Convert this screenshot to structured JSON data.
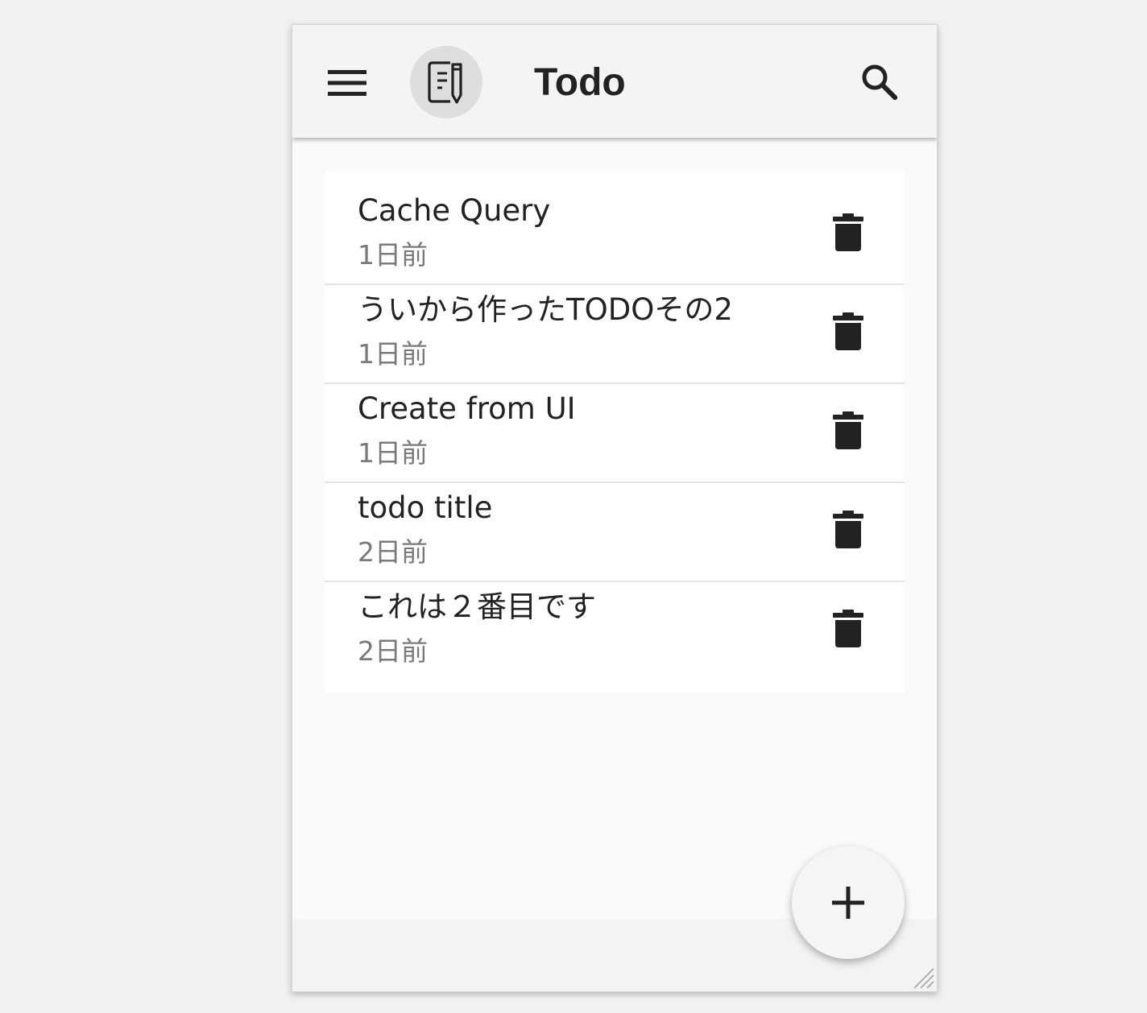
{
  "header": {
    "title": "Todo",
    "menu_icon": "menu-icon",
    "logo_icon": "note-pencil-icon",
    "search_icon": "search-icon"
  },
  "todos": [
    {
      "title": "Cache Query",
      "time": "1日前"
    },
    {
      "title": "ういから作ったTODOその2",
      "time": "1日前"
    },
    {
      "title": "Create from UI",
      "time": "1日前"
    },
    {
      "title": "todo title",
      "time": "2日前"
    },
    {
      "title": "これは２番目です",
      "time": "2日前"
    }
  ],
  "actions": {
    "delete_icon": "trash-icon",
    "add_icon": "plus-icon"
  },
  "colors": {
    "header_bg": "#f4f4f4",
    "logo_bg": "#dedede",
    "text": "#222222",
    "subtext": "#7a7a7a"
  }
}
